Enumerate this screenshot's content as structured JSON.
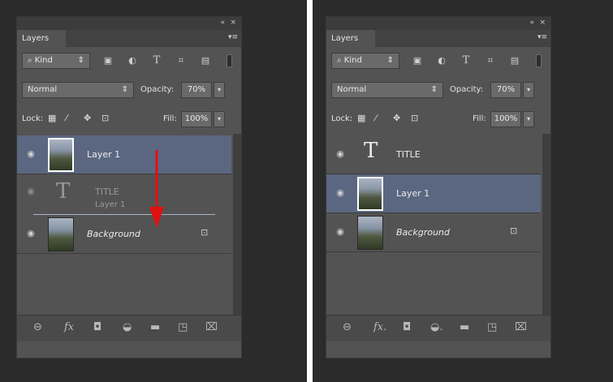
{
  "colors": {
    "panel_bg": "#535353",
    "selected_row": "#5b6780",
    "arrow": "#e01010"
  },
  "panels": [
    {
      "window_controls": {
        "collapse": "«",
        "close": "×"
      },
      "tab_label": "Layers",
      "filter": {
        "label": "Kind",
        "icons": [
          "image-filter-icon",
          "adjustment-filter-icon",
          "type-filter-icon",
          "shape-filter-icon",
          "smart-object-filter-icon"
        ]
      },
      "blend_mode": "Normal",
      "opacity": {
        "label": "Opacity:",
        "value": "70%"
      },
      "lock": {
        "label": "Lock:",
        "icons": [
          "lock-transparent-icon",
          "lock-image-icon",
          "lock-position-icon",
          "lock-all-icon"
        ]
      },
      "fill": {
        "label": "Fill:",
        "value": "100%"
      },
      "layers": [
        {
          "name": "Layer 1",
          "selected": true
        },
        {
          "name": "TITLE",
          "type": "text",
          "dragging": true
        },
        {
          "name": "Layer 1",
          "ghost": true
        },
        {
          "name": "Background",
          "locked": true
        }
      ],
      "bottom_icons": [
        "link-icon",
        "fx-icon",
        "mask-icon",
        "adjustment-icon",
        "folder-icon",
        "new-layer-icon",
        "trash-icon"
      ]
    },
    {
      "window_controls": {
        "collapse": "«",
        "close": "×"
      },
      "tab_label": "Layers",
      "filter": {
        "label": "Kind",
        "icons": [
          "image-filter-icon",
          "adjustment-filter-icon",
          "type-filter-icon",
          "shape-filter-icon",
          "smart-object-filter-icon"
        ]
      },
      "blend_mode": "Normal",
      "opacity": {
        "label": "Opacity:",
        "value": "70%"
      },
      "lock": {
        "label": "Lock:",
        "icons": [
          "lock-transparent-icon",
          "lock-image-icon",
          "lock-position-icon",
          "lock-all-icon"
        ]
      },
      "fill": {
        "label": "Fill:",
        "value": "100%"
      },
      "layers": [
        {
          "name": "TITLE",
          "type": "text"
        },
        {
          "name": "Layer 1",
          "selected": true
        },
        {
          "name": "Background",
          "locked": true
        }
      ],
      "bottom_icons": [
        "link-icon",
        "fx-icon",
        "mask-icon",
        "adjustment-icon",
        "folder-icon",
        "new-layer-icon",
        "trash-icon"
      ]
    }
  ]
}
